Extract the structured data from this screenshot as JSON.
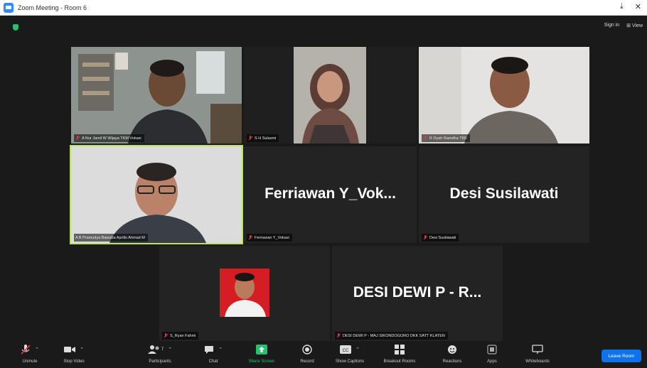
{
  "window": {
    "title": "Zoom Meeting - Room 6",
    "minimize_glyph": "⤓",
    "close_glyph": "✕"
  },
  "top_right": {
    "sign_in": "Sign in",
    "view": "View"
  },
  "tiles": [
    {
      "name": "A Nur Jamil W Wijaya TKM Vokasi",
      "big_name": "",
      "muted": true
    },
    {
      "name": "S H Sulasmi",
      "big_name": "",
      "muted": true
    },
    {
      "name": "R Dyah Ramdha TKK",
      "big_name": "",
      "muted": true
    },
    {
      "name": "A B Pramudya Bawaba Aprilio Ahmad M",
      "big_name": "",
      "muted": false
    },
    {
      "name": "Ferriawan Y_Vokasi",
      "big_name": "Ferriawan  Y_Vok...",
      "muted": true
    },
    {
      "name": "Desi Susilawati",
      "big_name": "Desi Susilawati",
      "muted": true
    },
    {
      "name": "S_Ryan Fahmi",
      "big_name": "",
      "muted": true
    },
    {
      "name": "DESI DEWI P - MAJ SIKONDOGORO DKK SATT KLATEN",
      "big_name": "DESI DEWI P - R...",
      "muted": true
    }
  ],
  "toolbar": {
    "unmute": "Unmute",
    "stop_video": "Stop Video",
    "participants": "Participants",
    "participants_count": "7",
    "chat": "Chat",
    "share_screen": "Share Screen",
    "record": "Record",
    "show_captions": "Show Captions",
    "breakout_rooms": "Breakout Rooms",
    "reactions": "Reactions",
    "apps": "Apps",
    "whiteboards": "Whiteboards",
    "leave_room": "Leave Room"
  },
  "colors": {
    "active_speaker_border": "#b9e35a",
    "share_green": "#23c26b",
    "leave_blue": "#0e72ed",
    "muted_red": "#e0383e"
  }
}
